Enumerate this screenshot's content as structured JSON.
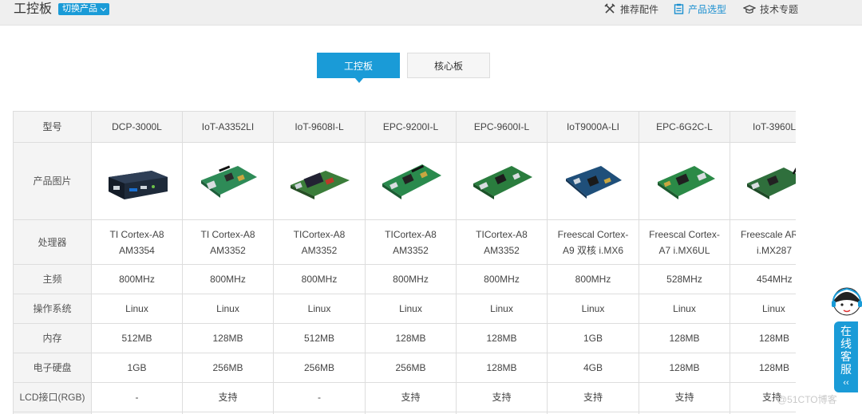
{
  "header": {
    "title": "工控板",
    "switch_label": "切换产品",
    "nav": [
      {
        "label": "推荐配件",
        "icon": "tools-icon"
      },
      {
        "label": "产品选型",
        "icon": "clipboard-icon"
      },
      {
        "label": "技术专题",
        "icon": "graduation-cap-icon"
      }
    ]
  },
  "tabs": [
    {
      "label": "工控板",
      "active": true
    },
    {
      "label": "核心板",
      "active": false
    }
  ],
  "table": {
    "corner_label": "型号",
    "models": [
      "DCP-3000L",
      "IoT-A3352LI",
      "IoT-9608I-L",
      "EPC-9200I-L",
      "EPC-9600I-L",
      "IoT9000A-LI",
      "EPC-6G2C-L",
      "IoT-3960L"
    ],
    "image_label": "产品图片",
    "rows": [
      {
        "label": "处理器",
        "values": [
          [
            "TI Cortex-A8",
            "AM3354"
          ],
          [
            "TI Cortex-A8",
            "AM3352"
          ],
          [
            "TICortex-A8",
            "AM3352"
          ],
          [
            "TICortex-A8",
            "AM3352"
          ],
          [
            "TICortex-A8",
            "AM3352"
          ],
          [
            "Freescal Cortex-",
            "A9 双核 i.MX6"
          ],
          [
            "Freescal Cortex-",
            "A7 i.MX6UL"
          ],
          [
            "Freescale AR",
            "i.MX287"
          ]
        ]
      },
      {
        "label": "主频",
        "values": [
          "800MHz",
          "800MHz",
          "800MHz",
          "800MHz",
          "800MHz",
          "800MHz",
          "528MHz",
          "454MHz"
        ]
      },
      {
        "label": "操作系统",
        "values": [
          "Linux",
          "Linux",
          "Linux",
          "Linux",
          "Linux",
          "Linux",
          "Linux",
          "Linux"
        ]
      },
      {
        "label": "内存",
        "values": [
          "512MB",
          "128MB",
          "512MB",
          "128MB",
          "128MB",
          "1GB",
          "128MB",
          "128MB"
        ]
      },
      {
        "label": "电子硬盘",
        "values": [
          "1GB",
          "256MB",
          "256MB",
          "256MB",
          "128MB",
          "4GB",
          "128MB",
          "128MB"
        ]
      },
      {
        "label": "LCD接口(RGB)",
        "values": [
          "-",
          "支持",
          "-",
          "支持",
          "支持",
          "支持",
          "支持",
          "支持"
        ]
      }
    ]
  },
  "service": {
    "label_chars": [
      "在",
      "线",
      "客",
      "服"
    ],
    "arrow": "‹‹"
  },
  "watermark": "@51CTO博客",
  "colors": {
    "accent": "#1a9bd7",
    "header_bg": "#efefef",
    "table_border": "#dddddd",
    "pcb_green": "#2e8b57"
  }
}
